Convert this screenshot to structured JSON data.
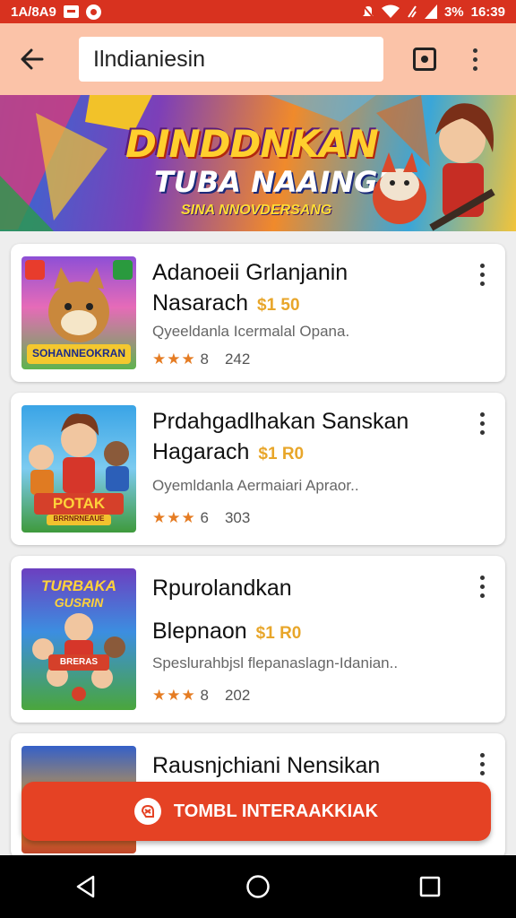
{
  "status_bar": {
    "left_text": "1A/8A9",
    "battery": "3%",
    "time": "16:39",
    "icons": [
      "message-icon",
      "notification-icon",
      "mute-icon",
      "wifi-icon",
      "data-icon",
      "signal-icon"
    ]
  },
  "app_bar": {
    "search_value": "Ilndianiesin",
    "icons": [
      "back-arrow-icon",
      "cast-icon",
      "more-vert-icon"
    ]
  },
  "banner": {
    "title": "DINDDNKAN",
    "subtitle": "TUBA NAAINGIN",
    "tagline": "SINA NNOVDERSANG"
  },
  "list": {
    "items": [
      {
        "title_line1": "Adanoeii Grlanjanin",
        "title_line2": "Nasarach",
        "price": "$1 50",
        "description": "Qyeeldanla Icermalal Opana.",
        "stars": "★★★",
        "rating": "8",
        "count": "242",
        "thumb_text": "SOHANNEOKRAN"
      },
      {
        "title_line1": "Prdahgadlhakan Sanskan",
        "title_line2": "Hagarach",
        "price": "$1 R0",
        "description": "Oyemldanla Aermaiari Apraor..",
        "stars": "★★★",
        "rating": "6",
        "count": "303",
        "thumb_text": "POTAK",
        "thumb_sub": "BRRNRNEAUE"
      },
      {
        "title_line1": "Rpurolandkan",
        "title_line2": "Blepnaon",
        "price": "$1 R0",
        "description": "Speslurahbjsl flepanaslagn-Idanian..",
        "stars": "★★★",
        "rating": "8",
        "count": "202",
        "thumb_text": "TURBAKA",
        "thumb_sub": "GUSRIN",
        "thumb_badge": "BRERAS"
      },
      {
        "title_line1": "Rausnjchiani Nensikan"
      }
    ]
  },
  "fab": {
    "label": "TOMBL INTERAAKKIAK",
    "icon": "hand-icon"
  },
  "nav_bar": {
    "icons": [
      "back-triangle-icon",
      "home-circle-icon",
      "recents-square-icon"
    ]
  },
  "colors": {
    "status_bar": "#d8321f",
    "app_bar": "#fbc3a8",
    "fab": "#e54224",
    "price": "#e8a62a",
    "stars": "#e57c23"
  }
}
